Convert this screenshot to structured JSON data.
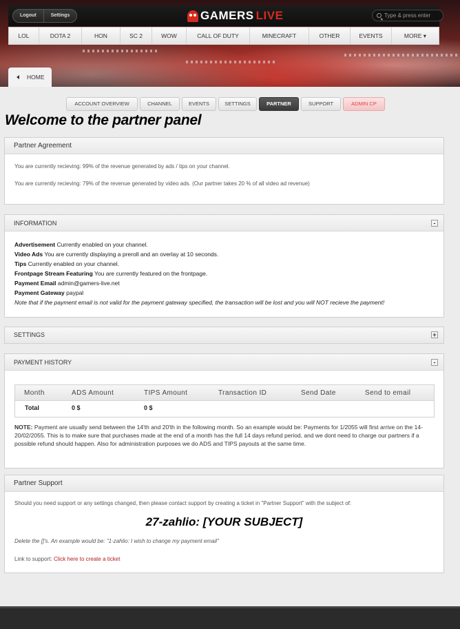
{
  "header": {
    "account_links": [
      "Logout",
      "Settings"
    ],
    "logo": {
      "part1": "GAMERS",
      "part2": "LIVE"
    },
    "search_placeholder": "Type & press enter",
    "nav": [
      "LOL",
      "DOTA 2",
      "HON",
      "SC 2",
      "WOW",
      "CALL OF DUTY",
      "MINECRAFT",
      "OTHER",
      "EVENTS",
      "MORE"
    ],
    "home": "HOME"
  },
  "tabs": [
    "ACCOUNT OVERVIEW",
    "CHANNEL",
    "EVENTS",
    "SETTINGS",
    "PARTNER",
    "SUPPORT",
    "ADMIN CP"
  ],
  "active_tab": "PARTNER",
  "page_title": "Welcome to the partner panel",
  "agreement": {
    "title": "Partner Agreement",
    "line1": "You are currently recieving: 99% of the revenue generated by ads / tips on your channel.",
    "line2": "You are currently recieving: 79% of the revenue generated by video ads. (Our partner takes 20 % of all video ad revenue)"
  },
  "information": {
    "title": "INFORMATION",
    "toggle": "-",
    "rows": [
      {
        "label": "Advertisement",
        "value": "Currently enabled on your channel."
      },
      {
        "label": "Video Ads",
        "value": "You are currently displaying a preroll and an overlay at 10 seconds."
      },
      {
        "label": "Tips",
        "value": "Currently enabled on your channel."
      },
      {
        "label": "Frontpage Stream Featuring",
        "value": "You are currently featured on the frontpage."
      },
      {
        "label": "Payment Email",
        "value": "admin@gamers-live.net"
      },
      {
        "label": "Payment Gateway",
        "value": "paypal"
      }
    ],
    "note": "Note that if the payment email is not valid for the payment gateway specified, the transaction will be lost and you will NOT recieve the payment!"
  },
  "settings": {
    "title": "SETTINGS",
    "toggle": "+"
  },
  "payment_history": {
    "title": "PAYMENT HISTORY",
    "toggle": "-",
    "columns": [
      "Month",
      "ADS Amount",
      "TIPS Amount",
      "Transaction ID",
      "Send Date",
      "Send to email"
    ],
    "total_row": [
      "Total",
      "0 $",
      "0 $",
      "",
      "",
      ""
    ],
    "note_label": "NOTE:",
    "note": "Payment are usually send between the 14'th and 20'th in the following month. So an example would be: Payments for 1/2055 will first arrive on the 14-20/02/2055. This is to make sure that purchases made at the end of a month has the full 14 days refund period, and we dont need to charge our partners if a possible refund should happen. Also for administration purposes we do ADS and TIPS payouts at the same time."
  },
  "support": {
    "title": "Partner Support",
    "intro": "Should you need support or any settings changed, then please contact support by creating a ticket in \"Partner Support\" with the subject of:",
    "subject": "27-zahlio: [YOUR SUBJECT]",
    "example": "Delete the []'s. An example would be: \"1-zahlio: I wish to change my payment email\"",
    "link_label": "Link to support:",
    "link_text": "Click here to create a ticket"
  }
}
